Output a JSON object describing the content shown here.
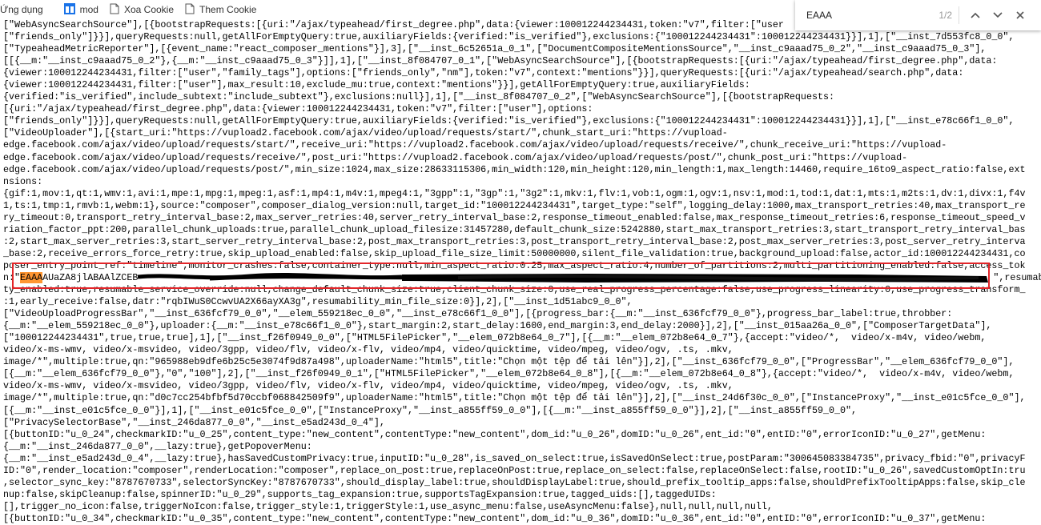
{
  "bookmarks": [
    {
      "label": "Ứng dụng",
      "icon": "apps-grid-icon"
    },
    {
      "label": "mod",
      "icon": "bookmark-blue-icon"
    },
    {
      "label": "Xoa Cookie",
      "icon": "page-icon"
    },
    {
      "label": "Them Cookie",
      "icon": "page-icon"
    }
  ],
  "find_bar": {
    "query": "EAAA",
    "count": "1/2",
    "prev": "^",
    "next": "v",
    "close": "✕"
  },
  "colors": {
    "highlight_active": "#ff9632",
    "annotation_box": "#e3262a"
  },
  "source_lines": [
    "[\"WebAsyncSearchSource\"],[{bootstrapRequests:[{uri:\"/ajax/typeahead/first_degree.php\",data:{viewer:100012244234431,token:\"v7\",filter:[\"user",
    "[\"friends_only\"]}}],queryRequests:null,getAllForEmptyQuery:true,auxiliaryFields:{verified:\"is_verified\"},exclusions:{\"100012244234431\":100012244234431}}],1],[\"__inst_7d553fc8_0_0\",",
    "[\"TypeaheadMetricReporter\"],[{event_name:\"react_composer_mentions\"}],3],[\"__inst_6c52651a_0_1\",[\"DocumentCompositeMentionsSource\",\"__inst_c9aaad75_0_2\",\"__inst_c9aaad75_0_3\"],",
    "[[{__m:\"__inst_c9aaad75_0_2\"},{__m:\"__inst_c9aaad75_0_3\"}]],1],[\"__inst_8f084707_0_1\",[\"WebAsyncSearchSource\"],[{bootstrapRequests:[{uri:\"/ajax/typeahead/first_degree.php\",data:",
    "{viewer:100012244234431,filter:[\"user\",\"family_tags\"],options:[\"friends_only\",\"nm\"],token:\"v7\",context:\"mentions\"}}],queryRequests:[{uri:\"/ajax/typeahead/search.php\",data:",
    "{viewer:100012244234431,filter:[\"user\"],max_result:10,exclude_mu:true,context:\"mentions\"}}],getAllForEmptyQuery:true,auxiliaryFields:",
    "{verified:\"is_verified\",include_subtext:\"include_subtext\"},exclusions:null}],1],[\"__inst_8f084707_0_2\",[\"WebAsyncSearchSource\"],[{bootstrapRequests:",
    "[{uri:\"/ajax/typeahead/first_degree.php\",data:{viewer:100012244234431,token:\"v7\",filter:[\"user\"],options:",
    "[\"friends_only\"]}}],queryRequests:null,getAllForEmptyQuery:true,auxiliaryFields:{verified:\"is_verified\"},exclusions:{\"100012244234431\":100012244234431}}],1],[\"__inst_e78c66f1_0_0\",",
    "[\"VideoUploader\"],[{start_uri:\"https://vupload2.facebook.com/ajax/video/upload/requests/start/\",chunk_start_uri:\"https://vupload-",
    "edge.facebook.com/ajax/video/upload/requests/start/\",receive_uri:\"https://vupload2.facebook.com/ajax/video/upload/requests/receive/\",chunk_receive_uri:\"https://vupload-",
    "edge.facebook.com/ajax/video/upload/requests/receive/\",post_uri:\"https://vupload2.facebook.com/ajax/video/upload/requests/post/\",chunk_post_uri:\"https://vupload-",
    "edge.facebook.com/ajax/video/upload/requests/post/\",min_size:1024,max_size:28633115306,min_width:120,min_height:120,min_length:1,max_length:14460,require_16to9_aspect_ratio:false,ext",
    "nsions:",
    "{gif:1,mov:1,qt:1,wmv:1,avi:1,mpe:1,mpg:1,mpeg:1,asf:1,mp4:1,m4v:1,mpeg4:1,\"3gpp\":1,\"3gp\":1,\"3g2\":1,mkv:1,flv:1,vob:1,ogm:1,ogv:1,nsv:1,mod:1,tod:1,dat:1,mts:1,m2ts:1,dv:1,divx:1,f4v",
    "1,ts:1,tmp:1,rmvb:1,webm:1},source:\"composer\",composer_dialog_version:null,target_id:\"100012244234431\",target_type:\"self\",logging_delay:1000,max_transport_retries:40,max_transport_re",
    "ry_timeout:0,transport_retry_interval_base:2,max_server_retries:40,server_retry_interval_base:2,response_timeout_enabled:false,max_response_timeout_retries:6,response_timeout_speed_v",
    "riation_factor_ppt:200,parallel_chunk_uploads:true,parallel_chunk_upload_filesize:31457280,default_chunk_size:5242880,start_max_transport_retries:3,start_transport_retry_interval_bas",
    ":2,start_max_server_retries:3,start_server_retry_interval_base:2,post_max_transport_retries:3,post_transport_retry_interval_base:2,post_max_server_retries:3,post_server_retry_interva",
    "_base:2,receive_errors_force_retry:true,skip_upload_enabled:false,skip_upload_file_size_limit:50000000,silent_file_validation:true,background_upload:false,actor_id:100012244234431,co",
    "poser_entry_point_ref:\"timeline\",monitor_crashes:false,container_type:null,min_aspect_ratio:0.25,max_aspect_ratio:4,number_of_partitions:2,multi_partitioning_enabled:false,access_tok",
    null,
    "ty_enabled:true,resumable_service_override:null,change_default_chunk_size:true,client_chunk_size:0,use_real_progress_percentage:false,use_progress_linearity:0,use_progress_transform_",
    ":1,early_receive:false,datr:\"rqbIWuS0CcwvUA2X66ayXA3g\",resumability_min_file_size:0}],2],[\"__inst_1d51abc9_0_0\",",
    "[\"VideoUploadProgressBar\",\"__inst_636fcf79_0_0\",\"__elem_559218ec_0_0\",\"__inst_e78c66f1_0_0\"],[{progress_bar:{__m:\"__inst_636fcf79_0_0\"},progress_bar_label:true,throbber:",
    "{__m:\"__elem_559218ec_0_0\"},uploader:{__m:\"__inst_e78c66f1_0_0\"},start_margin:2,start_delay:1600,end_margin:3,end_delay:2000}],2],[\"__inst_015aa26a_0_0\",[\"ComposerTargetData\"],",
    "[\"100012244234431\",true,true,true],1],[\"__inst_f26f0949_0_0\",[\"HTML5FilePicker\",\"__elem_072b8e64_0_7\"],[{__m:\"__elem_072b8e64_0_7\"},{accept:\"video/*,  video/x-m4v, video/webm,",
    "video/x-ms-wmv, video/x-msvideo, video/3gpp, video/flv, video/x-flv, video/mp4, video/quicktime, video/mpeg, video/ogv, .ts, .mkv,",
    "image/*\",multiple:true,qn:\"965988eb9dfe6b25c5e3074f9d87a498\",uploaderName:\"html5\",title:\"Chọn một tệp để tải lên\"}],2],[\"__inst_636fcf79_0_0\",[\"ProgressBar\",\"__elem_636fcf79_0_0\"],",
    "[{__m:\"__elem_636fcf79_0_0\"},\"0\",\"100\"],2],[\"__inst_f26f0949_0_1\",[\"HTML5FilePicker\",\"__elem_072b8e64_0_8\"],[{__m:\"__elem_072b8e64_0_8\"},{accept:\"video/*,  video/x-m4v, video/webm,",
    "video/x-ms-wmv, video/x-msvideo, video/3gpp, video/flv, video/x-flv, video/mp4, video/quicktime, video/mpeg, video/ogv, .ts, .mkv,",
    "image/*\",multiple:true,qn:\"d0c7cc254bfbf5d70ccbf068842509f9\",uploaderName:\"html5\",title:\"Chọn một tệp để tải lên\"}],2],[\"__inst_24d6f30c_0_0\",[\"InstanceProxy\",\"__inst_e01c5fce_0_0\"],",
    "[{__m:\"__inst_e01c5fce_0_0\"}],1],[\"__inst_e01c5fce_0_0\",[\"InstanceProxy\",\"__inst_a855ff59_0_0\"],[{__m:\"__inst_a855ff59_0_0\"}],2],[\"__inst_a855ff59_0_0\",",
    "[\"PrivacySelectorBase\",\"__inst_246da877_0_0\",\"__inst_e5ad243d_0_4\"],",
    "[{buttonID:\"u_0_24\",checkmarkID:\"u_0_25\",content_type:\"new_content\",contentType:\"new_content\",dom_id:\"u_0_26\",domID:\"u_0_26\",ent_id:\"0\",entID:\"0\",errorIconID:\"u_0_27\",getMenu:",
    "{__m:\"__inst_246da877_0_0\",__lazy:true},getPopoverMenu:",
    "{__m:\"__inst_e5ad243d_0_4\",__lazy:true},hasSavedCustomPrivacy:true,inputID:\"u_0_28\",is_saved_on_select:true,isSavedOnSelect:true,postParam:\"300645083384735\",privacy_fbid:\"0\",privacyF",
    "ID:\"0\",render_location:\"composer\",renderLocation:\"composer\",replace_on_post:true,replaceOnPost:true,replace_on_select:false,replaceOnSelect:false,rootID:\"u_0_26\",savedCustomOptIn:tru",
    ",selector_sync_key:\"8787670733\",selectorSyncKey:\"8787670733\",should_display_label:true,shouldDisplayLabel:true,should_prefix_tooltip_apps:false,shouldPrefixTooltipApps:false,skip_cle",
    "nup:false,skipCleanup:false,spinnerID:\"u_0_29\",supports_tag_expansion:true,supportsTagExpansion:true,tagged_uids:[],taggedUIDs:",
    "[],trigger_no_icon:false,triggerNoIcon:false,trigger_style:1,triggerStyle:1,use_async_menu:false,useAsyncMenu:false},null,null,null,null,",
    "[{buttonID:\"u_0_34\",checkmarkID:\"u_0_35\",content_type:\"new_content\",contentType:\"new_content\",dom_id:\"u_0_36\",domID:\"u_0_36\",ent_id:\"0\",entID:\"0\",errorIconID:\"u_0_37\",getMenu:"
  ],
  "token_line": {
    "prefix": "n:\"",
    "match": "EAAA",
    "rest": "AUaZA8jlABAAlZCEB",
    "suffix": "\",resumabili"
  }
}
